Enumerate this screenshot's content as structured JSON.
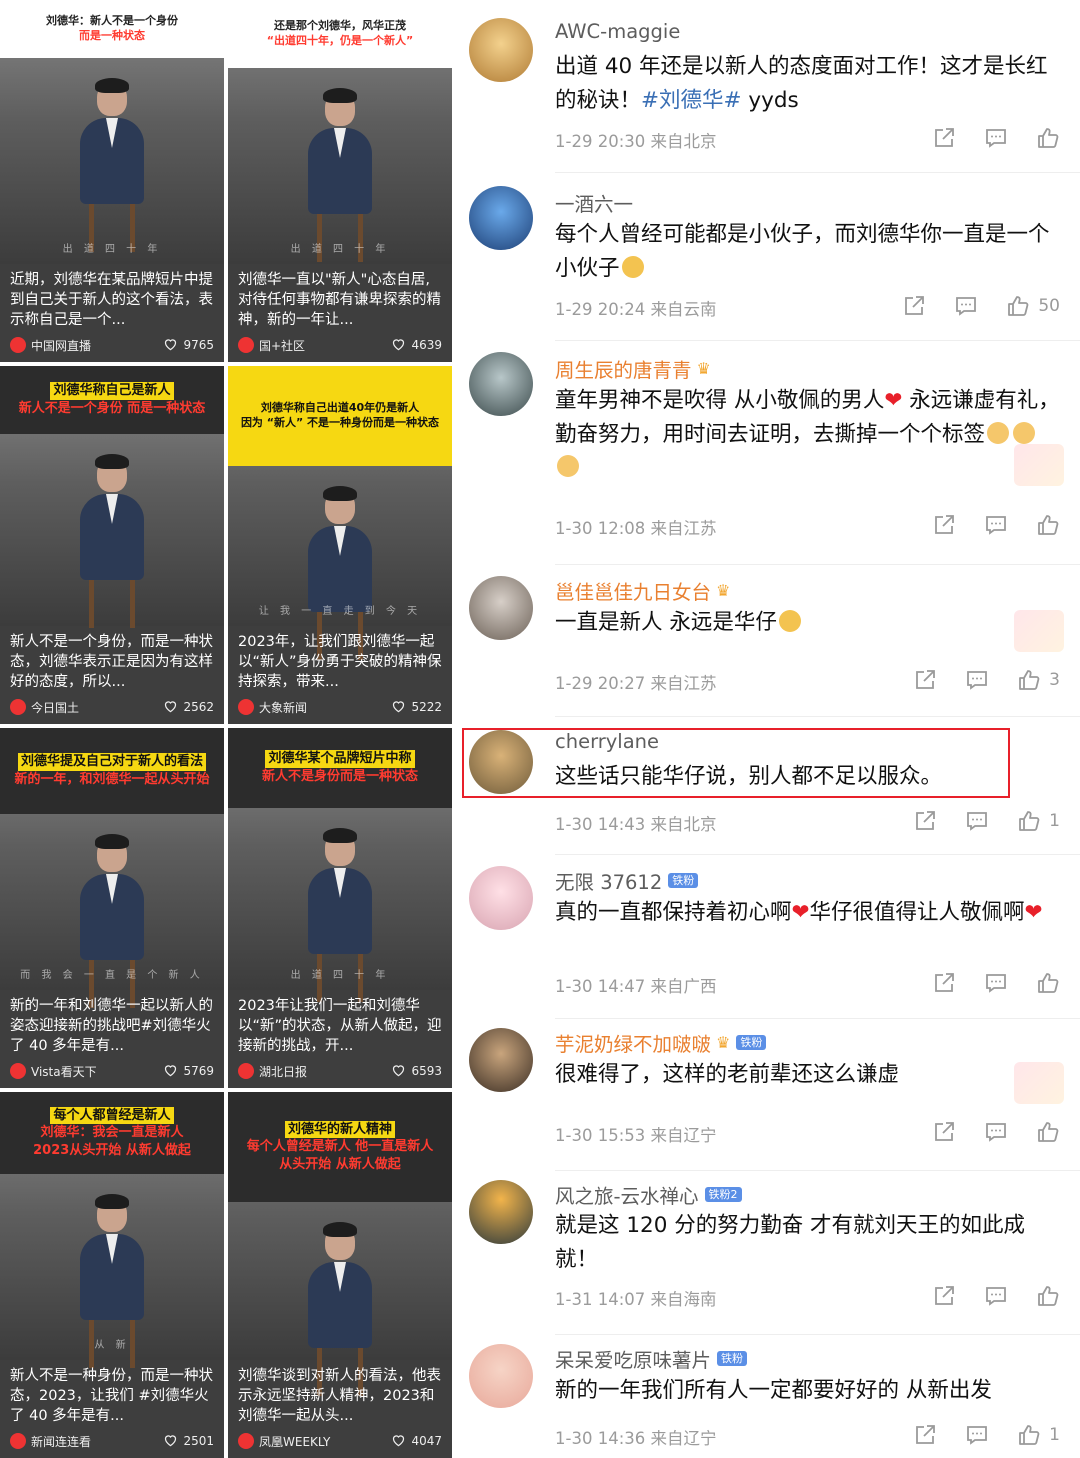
{
  "videos": [
    {
      "banner": [
        "刘德华：新人不是一个身份",
        "而是一种状态"
      ],
      "style": "white",
      "subtitle": "出 道 四 十 年",
      "desc": "近期，刘德华在某品牌短片中提到自己关于新人的这个看法，表示称自己是一个...",
      "source": "中国网直播",
      "likes": "9765"
    },
    {
      "banner": [
        "还是那个刘德华，风华正茂",
        "“出道四十年，仍是一个新人”"
      ],
      "style": "white",
      "subtitle": "出 道 四 十 年",
      "desc": "刘德华一直以\"新人\"心态自居,对待任何事物都有谦卑探索的精神，新的一年让...",
      "source": "国+社区",
      "likes": "4639"
    },
    {
      "banner": [
        "刘德华称自己是新人",
        "新人不是一个身份 而是一种状态"
      ],
      "style": "dark",
      "subtitle": "",
      "desc": "新人不是一个身份，而是一种状态，刘德华表示正是因为有这样好的态度，所以...",
      "source": "今日国土",
      "likes": "2562"
    },
    {
      "banner": [
        "刘德华称自己出道40年仍是新人",
        "因为 “新人” 不是一种身份而是一种状态"
      ],
      "style": "yellow",
      "subtitle": "让 我 一 直 走 到 今 天",
      "desc": "2023年，让我们跟刘德华一起以“新人”身份勇于突破的精神保持探索，带来...",
      "source": "大象新闻",
      "likes": "5222"
    },
    {
      "banner": [
        "刘德华提及自己对于新人的看法",
        "新的一年，和刘德华一起从头开始"
      ],
      "style": "dark",
      "subtitle": "而 我 会 一 直 是 个 新 人",
      "desc": "新的一年和刘德华一起以新人的姿态迎接新的挑战吧#刘德华火了 40 多年是有...",
      "source": "Vista看天下",
      "likes": "5769"
    },
    {
      "banner": [
        "刘德华某个品牌短片中称",
        "新人不是身份而是一种状态"
      ],
      "style": "dark",
      "subtitle": "出 道 四 十 年",
      "desc": "2023年让我们一起和刘德华以“新”的状态，从新人做起，迎接新的挑战，开...",
      "source": "湖北日报",
      "likes": "6593"
    },
    {
      "banner": [
        "每个人都曾经是新人",
        "刘德华：我会一直是新人",
        "2023从头开始 从新人做起"
      ],
      "style": "dark",
      "subtitle": "从 新",
      "desc": "新人不是一种身份，而是一种状态，2023，让我们 #刘德华火了 40 多年是有...",
      "source": "新闻连连看",
      "likes": "2501"
    },
    {
      "banner": [
        "刘德华的新人精神",
        "每个人曾经是新人 他一直是新人",
        "从头开始 从新人做起"
      ],
      "style": "dark",
      "subtitle": "",
      "desc": "刘德华谈到对新人的看法，他表示永远坚持新人精神，2023和刘德华一起从头...",
      "source": "凤凰WEEKLY",
      "likes": "4047"
    }
  ],
  "comments": [
    {
      "user": "AWC-maggie",
      "gold": false,
      "badge": "",
      "text_pre": "出道 40 年还是以新人的态度面对工作！这才是长红的秘诀！",
      "tag": "#刘德华#",
      "text_post": " yyds",
      "time": "1-29 20:30",
      "loc": "来自北京",
      "likes": ""
    },
    {
      "user": "一酒六一",
      "gold": false,
      "badge": "",
      "text_pre": "每个人曾经可能都是小伙子，而刘德华你一直是一个小伙子",
      "tag": "",
      "text_post": "",
      "time": "1-29 20:24",
      "loc": "来自云南",
      "likes": "50"
    },
    {
      "user": "周生辰的唐青青",
      "gold": true,
      "badge": "",
      "text_pre": "童年男神不是吹得 从小敬佩的男人",
      "tag": "",
      "text_post": " 永远谦虚有礼，勤奋努力，用时间去证明，去撕掉一个个标签",
      "time": "1-30 12:08",
      "loc": "来自江苏",
      "likes": ""
    },
    {
      "user": "邕佳邕佳九日女台",
      "gold": true,
      "badge": "",
      "text_pre": "一直是新人 永远是华仔",
      "tag": "",
      "text_post": "",
      "time": "1-29 20:27",
      "loc": "来自江苏",
      "likes": "3"
    },
    {
      "user": "cherrylane",
      "gold": false,
      "badge": "",
      "text_pre": "这些话只能华仔说，别人都不足以服众。",
      "tag": "",
      "text_post": "",
      "time": "1-30 14:43",
      "loc": "来自北京",
      "likes": "1"
    },
    {
      "user": "无限 37612",
      "gold": false,
      "badge": "铁粉",
      "text_pre": "真的一直都保持着初心啊",
      "tag": "",
      "text_post": "华仔很值得让人敬佩啊",
      "time": "1-30 14:47",
      "loc": "来自广西",
      "likes": ""
    },
    {
      "user": "芋泥奶绿不加啵啵",
      "gold": true,
      "badge": "铁粉",
      "text_pre": "很难得了，这样的老前辈还这么谦虚",
      "tag": "",
      "text_post": "",
      "time": "1-30 15:53",
      "loc": "来自辽宁",
      "likes": ""
    },
    {
      "user": "风之旅-云水禅心",
      "gold": false,
      "badge": "铁粉2",
      "text_pre": "就是这 120 分的努力勤奋 才有就刘天王的如此成就！",
      "tag": "",
      "text_post": "",
      "time": "1-31 14:07",
      "loc": "来自海南",
      "likes": ""
    },
    {
      "user": "呆呆爱吃原味薯片",
      "gold": false,
      "badge": "铁粉",
      "text_pre": "新的一年我们所有人一定都要好好的 从新出发",
      "tag": "",
      "text_post": "",
      "time": "1-30 14:36",
      "loc": "来自辽宁",
      "likes": "1"
    }
  ],
  "colors": {
    "highlight_border": "#e8202a",
    "gold_name": "#e98030",
    "tag_blue": "#3a6fb5",
    "badge_blue": "#5b8fe6"
  }
}
